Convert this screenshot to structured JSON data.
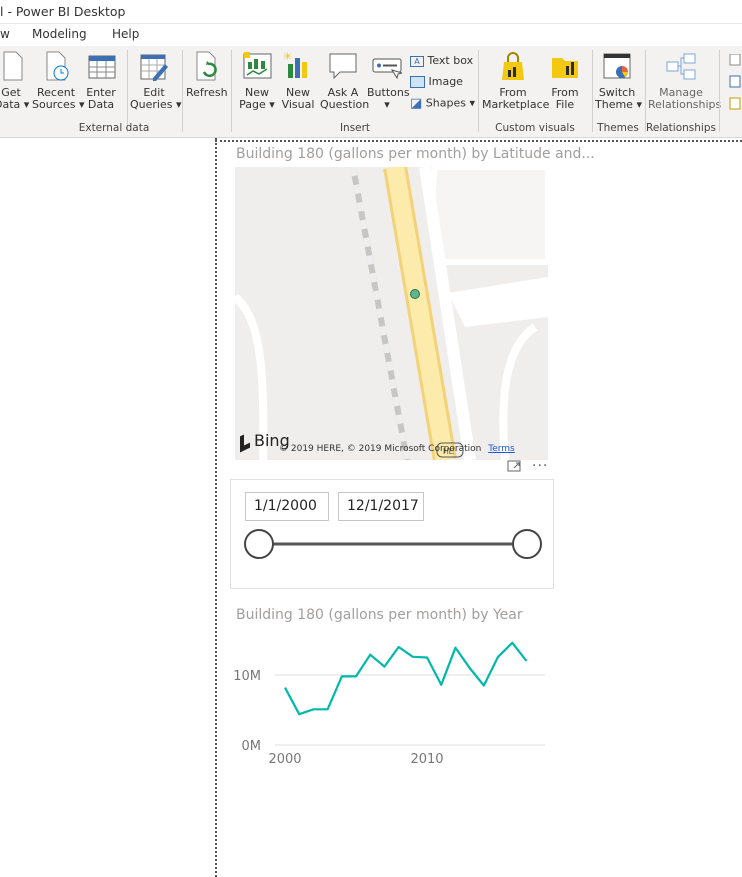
{
  "window": {
    "title": "l - Power BI Desktop"
  },
  "menu": [
    "w",
    "Modeling",
    "Help"
  ],
  "ribbon": {
    "buttons": [
      {
        "line1": "Get",
        "line2": "Data ▾"
      },
      {
        "line1": "Recent",
        "line2": "Sources ▾"
      },
      {
        "line1": "Enter",
        "line2": "Data"
      },
      {
        "line1": "Edit",
        "line2": "Queries ▾"
      },
      {
        "line1": "Refresh",
        "line2": ""
      },
      {
        "line1": "New",
        "line2": "Page ▾"
      },
      {
        "line1": "New",
        "line2": "Visual"
      },
      {
        "line1": "Ask A",
        "line2": "Question"
      },
      {
        "line1": "Buttons",
        "line2": "▾"
      },
      {
        "line1": "From",
        "line2": "Marketplace"
      },
      {
        "line1": "From",
        "line2": "File"
      },
      {
        "line1": "Switch",
        "line2": "Theme ▾"
      },
      {
        "line1": "Manage",
        "line2": "Relationships"
      }
    ],
    "small": {
      "textbox": "Text box",
      "image": "Image",
      "shapes": "Shapes ▾"
    },
    "groups": {
      "external": "External data",
      "insert": "Insert",
      "custom": "Custom visuals",
      "themes": "Themes",
      "relationships": "Relationships"
    }
  },
  "map_visual": {
    "title": "Building 180 (gallons per month) by Latitude and...",
    "attribution": "© 2019 HERE, © 2019 Microsoft Corporation",
    "terms": "Terms",
    "bing": "Bing"
  },
  "slicer": {
    "start": "1/1/2000",
    "end": "12/1/2017",
    "more": "···"
  },
  "line_visual": {
    "title": "Building 180 (gallons per month) by Year"
  },
  "chart_data": {
    "type": "line",
    "title": "Building 180 (gallons per month) by Year",
    "x": [
      2000,
      2001,
      2002,
      2003,
      2004,
      2005,
      2006,
      2007,
      2008,
      2009,
      2010,
      2011,
      2012,
      2013,
      2014,
      2015,
      2016,
      2017
    ],
    "values": [
      8.2,
      4.4,
      5.1,
      5.1,
      9.8,
      9.8,
      12.9,
      11.2,
      14.0,
      12.6,
      12.5,
      8.6,
      13.9,
      11.0,
      8.5,
      12.6,
      14.6,
      12.0
    ],
    "unit": "M",
    "xticks": [
      "2000",
      "2010"
    ],
    "yticks": [
      "0M",
      "10M"
    ],
    "ylim": [
      0,
      15
    ],
    "color": "#01b8aa",
    "grid": true
  }
}
